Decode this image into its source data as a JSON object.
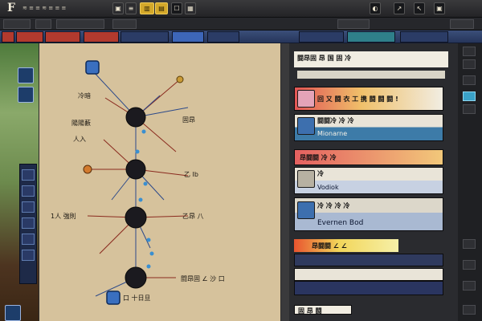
{
  "app": {
    "mark": "F",
    "menu_text": "≋ ≡ ≡ ≋ ≡ ≡ ≡"
  },
  "toolbar": {
    "buttons": [
      "▣",
      "≡",
      "▥",
      "▤",
      "☐",
      "▦"
    ],
    "right_buttons": [
      "◐",
      "↗",
      "↖",
      "▣"
    ]
  },
  "diagram": {
    "labels": [
      "冷暗",
      "陽陽藪",
      "人入",
      "固昂",
      "乙 Ib",
      "1人 強則",
      "乙昂 八",
      "闘昂固 ∠ 沙 口",
      "口 十日旦"
    ]
  },
  "panel": {
    "title": "闘昂固 昂 国 固 冷",
    "cards": {
      "a_body": "回 又 闘 衣 工 携 闘 闘 闘 !",
      "b_title": "闘闘冷 冷 冷",
      "b_body": "Mionarne",
      "c_title": "昂闘闘 冷 冷",
      "d_title": "冷",
      "d_body": "Vodiok",
      "e_title": "冷 冷 冷 冷",
      "e_body": "Evernen Bod",
      "f_body": "昂闘闘 ∠ ∠",
      "j_body": "固 昂 闘"
    }
  },
  "colors": {
    "canvas": "#d6c29c",
    "node": "#1b1a1f",
    "line_red": "#8a2a1e",
    "line_blue": "#2d4a8a",
    "accent_gold": "#d4a82a"
  }
}
